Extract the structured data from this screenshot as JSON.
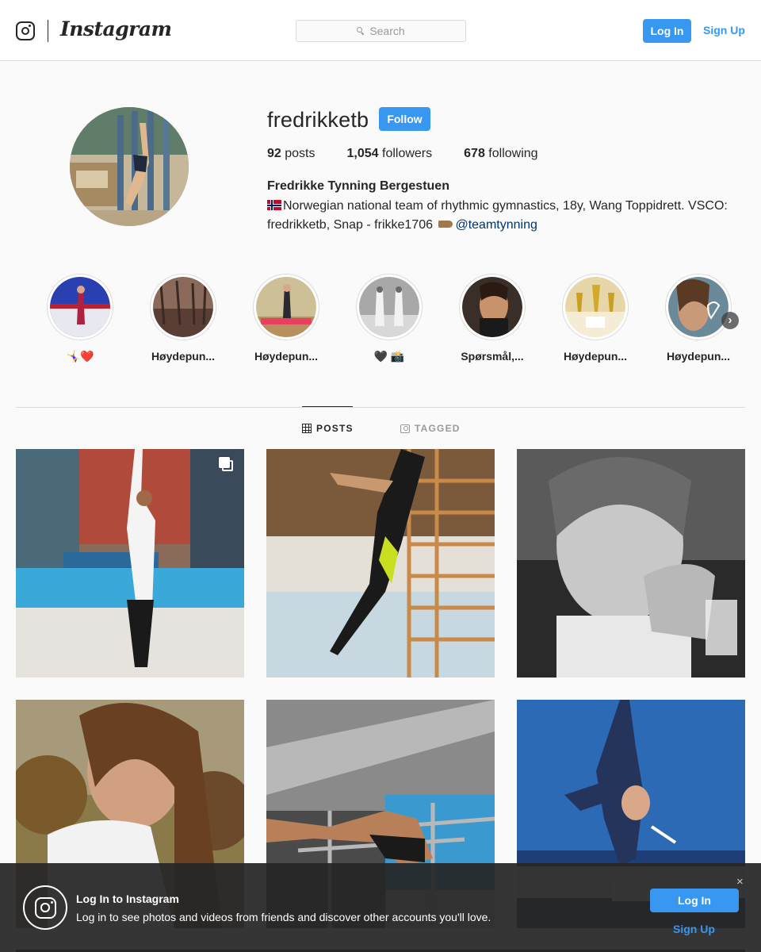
{
  "header": {
    "logo_text": "Instagram",
    "search_placeholder": "Search",
    "login_label": "Log In",
    "signup_label": "Sign Up"
  },
  "profile": {
    "username": "fredrikketb",
    "follow_label": "Follow",
    "posts_count": "92",
    "posts_label": "posts",
    "followers_count": "1,054",
    "followers_label": "followers",
    "following_count": "678",
    "following_label": "following",
    "full_name": "Fredrikke Tynning Bergestuen",
    "bio_text": "Norwegian national team of rhythmic gymnastics, 18y, Wang Toppidrett. VSCO: fredrikketb, Snap - frikke1706",
    "bio_mention": "@teamtynning"
  },
  "highlights": [
    {
      "label": "🤸‍♀️❤️"
    },
    {
      "label": "Høydepun..."
    },
    {
      "label": "Høydepun..."
    },
    {
      "label": "🖤 📸"
    },
    {
      "label": "Spørsmål,..."
    },
    {
      "label": "Høydepun..."
    },
    {
      "label": "Høydepun..."
    }
  ],
  "tabs": {
    "posts_label": "POSTS",
    "tagged_label": "TAGGED"
  },
  "login_bar": {
    "title": "Log In to Instagram",
    "text": "Log in to see photos and videos from friends and discover other accounts you'll love.",
    "login_label": "Log In",
    "signup_label": "Sign Up",
    "close_glyph": "×"
  },
  "colors": {
    "accent": "#3897f0",
    "mention": "#003569",
    "border": "#dbdbdb",
    "background": "#fafafa"
  }
}
